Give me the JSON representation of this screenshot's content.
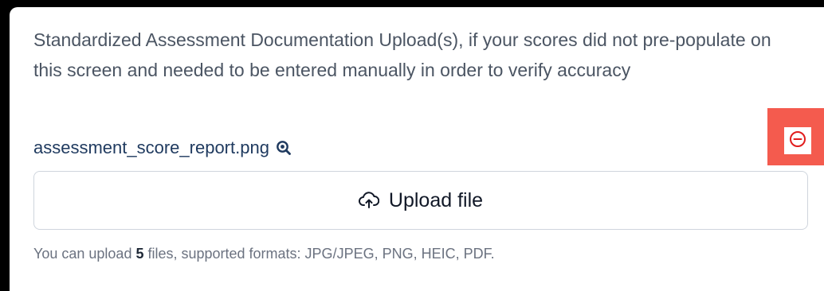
{
  "upload_section": {
    "description": "Standardized Assessment Documentation Upload(s), if your scores did not pre-populate on this screen and needed to be entered manually in order to verify accuracy",
    "file": {
      "name": "assessment_score_report.png",
      "preview_icon": "zoom-in-icon",
      "remove_icon": "minus-circle-icon"
    },
    "upload_button": {
      "label": "Upload file",
      "icon": "cloud-upload-icon"
    },
    "helper": {
      "prefix": "You can upload ",
      "max_files": "5",
      "suffix": " files, supported formats: JPG/JPEG, PNG, HEIC, PDF."
    }
  },
  "colors": {
    "remove_highlight": "#f45b4e",
    "remove_icon": "#e11d1d",
    "file_link": "#1f3a5f"
  }
}
